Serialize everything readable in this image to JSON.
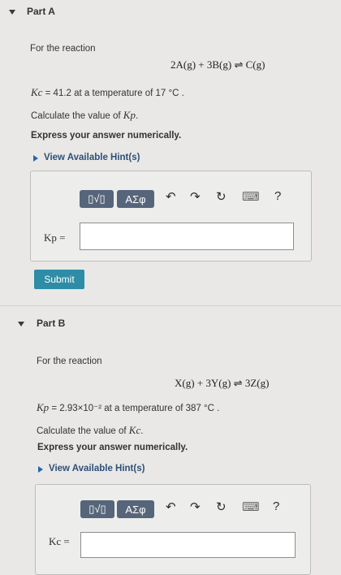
{
  "partA": {
    "title": "Part A",
    "intro": "For the reaction",
    "reaction": "2A(g) + 3B(g) ⇌ C(g)",
    "kc_symbol": "Kc",
    "kc_value_text": " = 41.2 at a temperature of 17 °C .",
    "calc_text_prefix": "Calculate the value of ",
    "calc_symbol": "Kp",
    "calc_text_suffix": ".",
    "express": "Express your answer numerically.",
    "hint": "View Available Hint(s)",
    "toolbar": {
      "templates": "▯√▯",
      "greek": "ΑΣφ",
      "undo": "↶",
      "redo": "↷",
      "reset": "↻",
      "keyboard": "⌨",
      "help": "?"
    },
    "answer_label": "Kp =",
    "answer_value": "",
    "submit_label": "Submit"
  },
  "partB": {
    "title": "Part B",
    "intro": "For the reaction",
    "reaction": "X(g) + 3Y(g) ⇌ 3Z(g)",
    "kp_symbol": "Kp",
    "kp_value_text": " = 2.93×10⁻² at a temperature of 387 °C .",
    "calc_text_prefix": "Calculate the value of ",
    "calc_symbol": "Kc",
    "calc_text_suffix": ".",
    "express": "Express your answer numerically.",
    "hint": "View Available Hint(s)",
    "toolbar": {
      "templates": "▯√▯",
      "greek": "ΑΣφ",
      "undo": "↶",
      "redo": "↷",
      "reset": "↻",
      "keyboard": "⌨",
      "help": "?"
    },
    "answer_label": "Kc =",
    "answer_value": ""
  }
}
